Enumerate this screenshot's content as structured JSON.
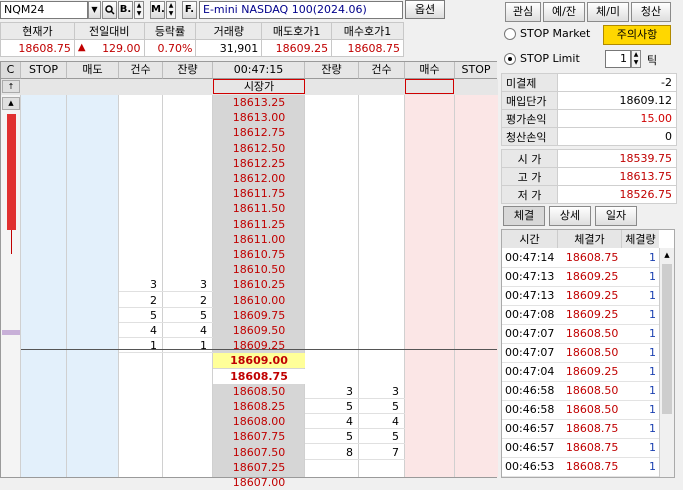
{
  "toolbar": {
    "symbol_code": "NQM24",
    "btn_b": "B.",
    "btn_m": "M.",
    "btn_f": "F.",
    "instrument_name": "E-mini NASDAQ 100(2024.06)",
    "options_label": "옵션"
  },
  "summary": {
    "headers": [
      "현재가",
      "전일대비",
      "등락률",
      "거래량",
      "매도호가1",
      "매수호가1"
    ],
    "current_price": "18608.75",
    "change_arrow": "▲",
    "change": "129.00",
    "change_rate": "0.70%",
    "volume": "31,901",
    "ask1": "18609.25",
    "bid1": "18608.75"
  },
  "grid_header": {
    "c_label": "C",
    "stop": "STOP",
    "sell": "매도",
    "count": "건수",
    "remaining": "잔량",
    "time": "00:47:15",
    "remaining_right": "잔량",
    "count_right": "건수",
    "buy": "매수",
    "stop_right": "STOP"
  },
  "market_price_label": "시장가",
  "ladder": [
    {
      "price": "18613.25"
    },
    {
      "price": "18613.00"
    },
    {
      "price": "18612.75"
    },
    {
      "price": "18612.50"
    },
    {
      "price": "18612.25"
    },
    {
      "price": "18612.00"
    },
    {
      "price": "18611.75"
    },
    {
      "price": "18611.50"
    },
    {
      "price": "18611.25"
    },
    {
      "price": "18611.00"
    },
    {
      "price": "18610.75"
    },
    {
      "price": "18610.50"
    },
    {
      "price": "18610.25",
      "ask_count": "3",
      "ask_qty": "3"
    },
    {
      "price": "18610.00",
      "ask_count": "2",
      "ask_qty": "2"
    },
    {
      "price": "18609.75",
      "ask_count": "5",
      "ask_qty": "5"
    },
    {
      "price": "18609.50",
      "ask_count": "4",
      "ask_qty": "4"
    },
    {
      "price": "18609.25",
      "ask_count": "1",
      "ask_qty": "1"
    },
    {
      "price": "18609.00",
      "highlight": "yellow"
    },
    {
      "price": "18608.75",
      "highlight": "current"
    },
    {
      "price": "18608.50",
      "bid_qty": "3",
      "bid_count": "3"
    },
    {
      "price": "18608.25",
      "bid_qty": "5",
      "bid_count": "5"
    },
    {
      "price": "18608.00",
      "bid_qty": "4",
      "bid_count": "4"
    },
    {
      "price": "18607.75",
      "bid_qty": "5",
      "bid_count": "5"
    },
    {
      "price": "18607.50",
      "bid_qty": "8",
      "bid_count": "7"
    },
    {
      "price": "18607.25"
    },
    {
      "price": "18607.00"
    }
  ],
  "right_panel": {
    "tabs": [
      "관심",
      "예/잔",
      "체/미",
      "청산"
    ],
    "stop_market": "STOP Market",
    "stop_limit": "STOP Limit",
    "notice_button": "주의사항",
    "tick_value": "1",
    "tick_label": "틱",
    "position": [
      {
        "label": "미결제",
        "value": "-2",
        "color": "#000000"
      },
      {
        "label": "매입단가",
        "value": "18609.12",
        "color": "#000000"
      },
      {
        "label": "평가손익",
        "value": "15.00",
        "color": "#d00000"
      },
      {
        "label": "청산손익",
        "value": "0",
        "color": "#000000"
      }
    ],
    "ohl": [
      {
        "label": "시 가",
        "value": "18539.75"
      },
      {
        "label": "고 가",
        "value": "18613.75"
      },
      {
        "label": "저 가",
        "value": "18526.75"
      }
    ],
    "sub_tabs": [
      "체결",
      "상세",
      "일자"
    ],
    "trades_header": [
      "시간",
      "체결가",
      "체결량"
    ],
    "trades": [
      {
        "time": "00:47:14",
        "price": "18608.75",
        "qty": "1"
      },
      {
        "time": "00:47:13",
        "price": "18609.25",
        "qty": "1"
      },
      {
        "time": "00:47:13",
        "price": "18609.25",
        "qty": "1"
      },
      {
        "time": "00:47:08",
        "price": "18609.25",
        "qty": "1"
      },
      {
        "time": "00:47:07",
        "price": "18608.50",
        "qty": "1"
      },
      {
        "time": "00:47:07",
        "price": "18608.50",
        "qty": "1"
      },
      {
        "time": "00:47:04",
        "price": "18609.25",
        "qty": "1"
      },
      {
        "time": "00:46:58",
        "price": "18608.50",
        "qty": "1"
      },
      {
        "time": "00:46:58",
        "price": "18608.50",
        "qty": "1"
      },
      {
        "time": "00:46:57",
        "price": "18608.75",
        "qty": "1"
      },
      {
        "time": "00:46:57",
        "price": "18608.75",
        "qty": "1"
      },
      {
        "time": "00:46:53",
        "price": "18608.75",
        "qty": "1"
      }
    ]
  },
  "colors": {
    "sell_bg": "#e3f0fb",
    "buy_bg": "#fbe6e6",
    "price_bg": "#d6d6d6",
    "up_red": "#c00000",
    "highlight_yellow": "#ffff99",
    "notice_yellow": "#ffd700"
  }
}
